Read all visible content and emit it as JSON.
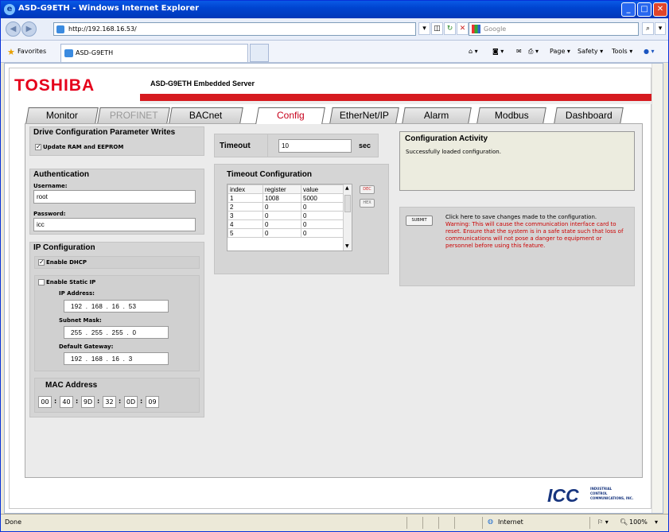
{
  "window": {
    "title": "ASD-G9ETH - Windows Internet Explorer"
  },
  "address": {
    "url": "http://192.168.16.53/",
    "search_placeholder": "Google"
  },
  "favorites": {
    "label": "Favorites",
    "tab_title": "ASD-G9ETH"
  },
  "commands": {
    "page": "Page ▾",
    "safety": "Safety ▾",
    "tools": "Tools ▾"
  },
  "header": {
    "brand": "TOSHIBA",
    "server_title": "ASD-G9ETH Embedded Server"
  },
  "tabs": [
    {
      "label": "Monitor"
    },
    {
      "label": "PROFINET"
    },
    {
      "label": "BACnet"
    },
    {
      "label": "Config"
    },
    {
      "label": "EtherNet/IP"
    },
    {
      "label": "Alarm"
    },
    {
      "label": "Modbus"
    },
    {
      "label": "Dashboard"
    }
  ],
  "drive_config": {
    "title": "Drive Configuration Parameter Writes",
    "option": "Update RAM and EEPROM"
  },
  "timeout": {
    "label": "Timeout",
    "value": "10",
    "unit": "sec"
  },
  "auth": {
    "title": "Authentication",
    "username_label": "Username:",
    "username": "root",
    "password_label": "Password:",
    "password": "icc"
  },
  "ip_config": {
    "title": "IP Configuration",
    "dhcp_label": "Enable DHCP",
    "static_label": "Enable Static IP",
    "ip_label": "IP Address:",
    "ip": "192 . 168 . 16 . 53",
    "mask_label": "Subnet Mask:",
    "mask": "255 . 255 . 255 . 0",
    "gateway_label": "Default Gateway:",
    "gateway": "192 . 168 . 16 . 3"
  },
  "mac": {
    "title": "MAC Address",
    "octets": [
      "00",
      "40",
      "9D",
      "32",
      "0D",
      "09"
    ],
    "separator": ":"
  },
  "timeout_config": {
    "title": "Timeout Configuration",
    "columns": [
      "index",
      "register",
      "value"
    ],
    "rows": [
      [
        "1",
        "1008",
        "5000"
      ],
      [
        "2",
        "0",
        "0"
      ],
      [
        "3",
        "0",
        "0"
      ],
      [
        "4",
        "0",
        "0"
      ],
      [
        "5",
        "0",
        "0"
      ]
    ],
    "dec_label": "DEC",
    "hex_label": "HEX"
  },
  "activity": {
    "title": "Configuration Activity",
    "message": "Successfully loaded configuration."
  },
  "submit": {
    "button": "SUBMIT",
    "text": "Click here to save changes made to the configuration.",
    "warning": "Warning: This will cause the communication interface card to reset. Ensure that the system is in a safe state such that loss of communications will not pose a danger to equipment or personnel before using this feature."
  },
  "footer_logo": {
    "mark": "ICC",
    "line1": "INDUSTRIAL",
    "line2": "CONTROL",
    "line3": "COMMUNICATIONS, INC."
  },
  "status": {
    "left": "Done",
    "zone": "Internet",
    "zoom": "100%"
  },
  "colors": {
    "brand_red": "#d61a1f",
    "warning_red": "#cc0000",
    "active_tab": "#c7001b"
  }
}
